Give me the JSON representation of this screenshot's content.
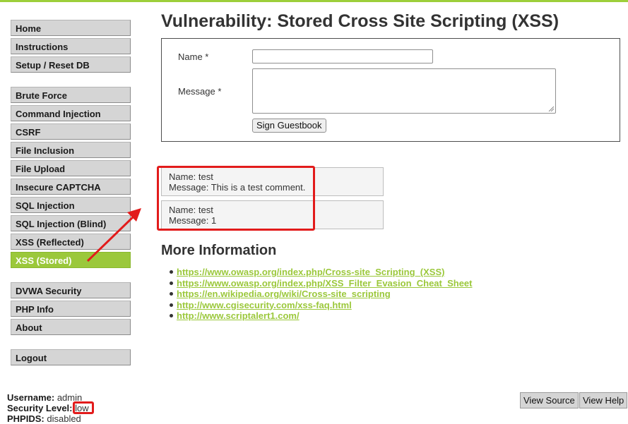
{
  "nav": {
    "group1": [
      "Home",
      "Instructions",
      "Setup / Reset DB"
    ],
    "group2": [
      "Brute Force",
      "Command Injection",
      "CSRF",
      "File Inclusion",
      "File Upload",
      "Insecure CAPTCHA",
      "SQL Injection",
      "SQL Injection (Blind)",
      "XSS (Reflected)",
      "XSS (Stored)"
    ],
    "group3": [
      "DVWA Security",
      "PHP Info",
      "About"
    ],
    "group4": [
      "Logout"
    ],
    "active": "XSS (Stored)"
  },
  "page": {
    "title": "Vulnerability: Stored Cross Site Scripting (XSS)"
  },
  "form": {
    "name_label": "Name *",
    "name_value": "",
    "message_label": "Message *",
    "message_value": "",
    "submit_label": "Sign Guestbook"
  },
  "entries": [
    {
      "name_line": "Name: test",
      "message_line": "Message: This is a test comment."
    },
    {
      "name_line": "Name: test",
      "message_line": "Message: 1"
    }
  ],
  "more": {
    "title": "More Information",
    "links": [
      "https://www.owasp.org/index.php/Cross-site_Scripting_(XSS)",
      "https://www.owasp.org/index.php/XSS_Filter_Evasion_Cheat_Sheet",
      "https://en.wikipedia.org/wiki/Cross-site_scripting",
      "http://www.cgisecurity.com/xss-faq.html",
      "http://www.scriptalert1.com/"
    ]
  },
  "footer": {
    "username_label": "Username:",
    "username_value": "admin",
    "security_label": "Security Level:",
    "security_value": "low",
    "phpids_label": "PHPIDS:",
    "phpids_value": "disabled",
    "view_source_label": "View Source",
    "view_help_label": "View Help"
  },
  "colors": {
    "accent": "#9bc83b",
    "annotation": "#e21b1b"
  },
  "icons": {
    "textarea_grip": "resize-grip-icon",
    "annotation_arrow": "arrow-icon"
  }
}
